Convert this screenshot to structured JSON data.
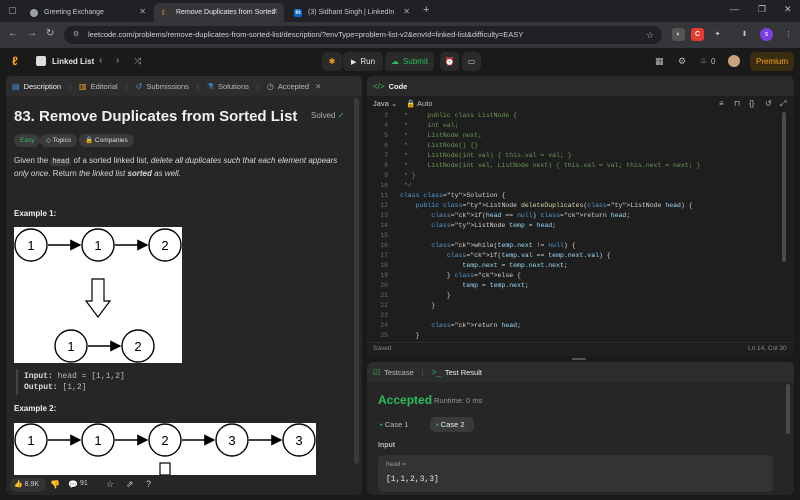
{
  "browser": {
    "tabs": [
      {
        "label": "Greeting Exchange",
        "fav_color": "#9aa0a6",
        "active": false
      },
      {
        "label": "Remove Duplicates from Sorted",
        "fav_color": "#f89f1b",
        "active": true
      },
      {
        "label": "(3) Sidhant Singh | LinkedIn",
        "fav_color": "#0a66c2",
        "fav_text": "in",
        "active": false
      }
    ],
    "url": "leetcode.com/problems/remove-duplicates-from-sorted-list/description/?envType=problem-list-v2&envId=linked-list&difficulty=EASY"
  },
  "lc_nav": {
    "list_label": "Linked List",
    "run_label": "Run",
    "submit_label": "Submit",
    "streak": "0",
    "premium_label": "Premium"
  },
  "left_panel": {
    "tabs": [
      {
        "label": "Description",
        "icon": "description-icon"
      },
      {
        "label": "Editorial",
        "icon": "editorial-icon"
      },
      {
        "label": "Submissions",
        "icon": "submissions-icon"
      },
      {
        "label": "Solutions",
        "icon": "solutions-icon"
      },
      {
        "label": "Accepted",
        "icon": "clock-icon"
      }
    ],
    "title": "83. Remove Duplicates from Sorted List",
    "status": "Solved",
    "chips": {
      "difficulty": "Easy",
      "topics": "Topics",
      "companies": "Companies"
    },
    "description": {
      "p1": "Given the",
      "p2": "head",
      "p3": "of a sorted linked list,",
      "p4": "delete all duplicates such that each element appears only once",
      "p5": ". Return",
      "p6": "the linked list",
      "p7": "sorted",
      "p8": "as well."
    },
    "example1": {
      "heading": "Example 1:",
      "top_nodes": [
        "1",
        "1",
        "2"
      ],
      "bottom_nodes": [
        "1",
        "2"
      ],
      "input_label": "Input:",
      "input_value": "head = [1,1,2]",
      "output_label": "Output:",
      "output_value": "[1,2]"
    },
    "example2": {
      "heading": "Example 2:",
      "top_nodes": [
        "1",
        "1",
        "2",
        "3",
        "3"
      ]
    },
    "footer": {
      "likes": "8.9K",
      "comments": "91"
    }
  },
  "code_panel": {
    "title": "Code",
    "language": "Java",
    "mode": "Auto",
    "saved": "Saved",
    "cursor": "Ln 14, Col 30",
    "lines": [
      {
        "n": "3",
        "t": " *     public class ListNode {"
      },
      {
        "n": "4",
        "t": " *     int val;"
      },
      {
        "n": "5",
        "t": " *     ListNode next;"
      },
      {
        "n": "6",
        "t": " *     ListNode() {}"
      },
      {
        "n": "7",
        "t": " *     ListNode(int val) { this.val = val; }"
      },
      {
        "n": "8",
        "t": " *     ListNode(int val, ListNode next) { this.val = val; this.next = next; }"
      },
      {
        "n": "9",
        "t": " * }"
      },
      {
        "n": "10",
        "t": " */"
      },
      {
        "n": "11",
        "t": "class Solution {"
      },
      {
        "n": "12",
        "t": "    public ListNode deleteDuplicates(ListNode head) {"
      },
      {
        "n": "13",
        "t": "        if(head == null) return head;"
      },
      {
        "n": "14",
        "t": "        ListNode temp = head;"
      },
      {
        "n": "15",
        "t": ""
      },
      {
        "n": "16",
        "t": "        while(temp.next != null) {"
      },
      {
        "n": "17",
        "t": "            if(temp.val == temp.next.val) {"
      },
      {
        "n": "18",
        "t": "                temp.next = temp.next.next;"
      },
      {
        "n": "19",
        "t": "            } else {"
      },
      {
        "n": "20",
        "t": "                temp = temp.next;"
      },
      {
        "n": "21",
        "t": "            }"
      },
      {
        "n": "22",
        "t": "        }"
      },
      {
        "n": "23",
        "t": ""
      },
      {
        "n": "24",
        "t": "        return head;"
      },
      {
        "n": "25",
        "t": "    }"
      }
    ]
  },
  "result_panel": {
    "tabs": {
      "testcase": "Testcase",
      "test_result": "Test Result"
    },
    "verdict": "Accepted",
    "runtime": "Runtime: 0 ms",
    "cases": [
      "Case 1",
      "Case 2"
    ],
    "input_label": "Input",
    "var_name": "head =",
    "var_value": "[1,1,2,3,3]"
  },
  "colors": {
    "accent_green": "#2cbb5d",
    "brand_orange": "#ffa116"
  }
}
